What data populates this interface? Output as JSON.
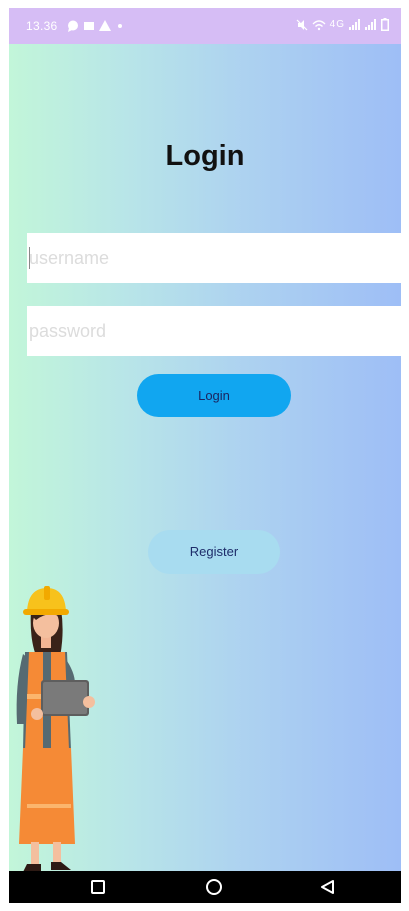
{
  "status_bar": {
    "time": "13.36",
    "right_indicators": "4G"
  },
  "login": {
    "title": "Login",
    "username_placeholder": "username",
    "password_placeholder": "password",
    "login_label": "Login",
    "register_label": "Register"
  },
  "colors": {
    "status_bar_bg": "#d6bdf5",
    "login_button": "#11a6f0",
    "register_button": "#a8dcf0",
    "gradient_start": "#c2f6d9",
    "gradient_end": "#9ebef6"
  },
  "icons": {
    "status_left": [
      "chat-bubble-icon",
      "message-icon",
      "alert-triangle-icon",
      "dot-icon"
    ],
    "status_right": [
      "mute-icon",
      "wifi-calling-icon",
      "signal-icon",
      "signal-icon",
      "battery-icon"
    ],
    "nav": [
      "recent-apps-icon",
      "home-icon",
      "back-icon"
    ]
  }
}
